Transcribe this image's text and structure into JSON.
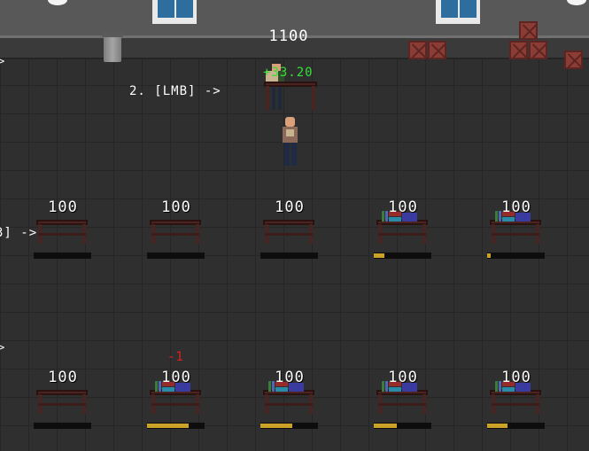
{
  "hud": {
    "score": "1100",
    "hint_2": "2. [LMB] ->",
    "hint_3": "3] ->",
    "float_gain": "+33.20",
    "float_loss": "-1"
  },
  "colors": {
    "floor": "#2f2f2f",
    "wall": "#585858",
    "desk": "#4a2420",
    "progress_fill": "#c9a227",
    "gain": "#35e135",
    "loss": "#e02020"
  },
  "stations": [
    {
      "value": "100",
      "books": false,
      "progress": 0
    },
    {
      "value": "100",
      "books": false,
      "progress": 0
    },
    {
      "value": "100",
      "books": false,
      "progress": 0
    },
    {
      "value": "100",
      "books": true,
      "progress": 0.18
    },
    {
      "value": "100",
      "books": true,
      "progress": 0.06
    },
    {
      "value": "100",
      "books": false,
      "progress": 0
    },
    {
      "value": "100",
      "books": true,
      "progress": 0.72
    },
    {
      "value": "100",
      "books": true,
      "progress": 0.55
    },
    {
      "value": "100",
      "books": true,
      "progress": 0.4
    },
    {
      "value": "100",
      "books": true,
      "progress": 0.35
    }
  ]
}
